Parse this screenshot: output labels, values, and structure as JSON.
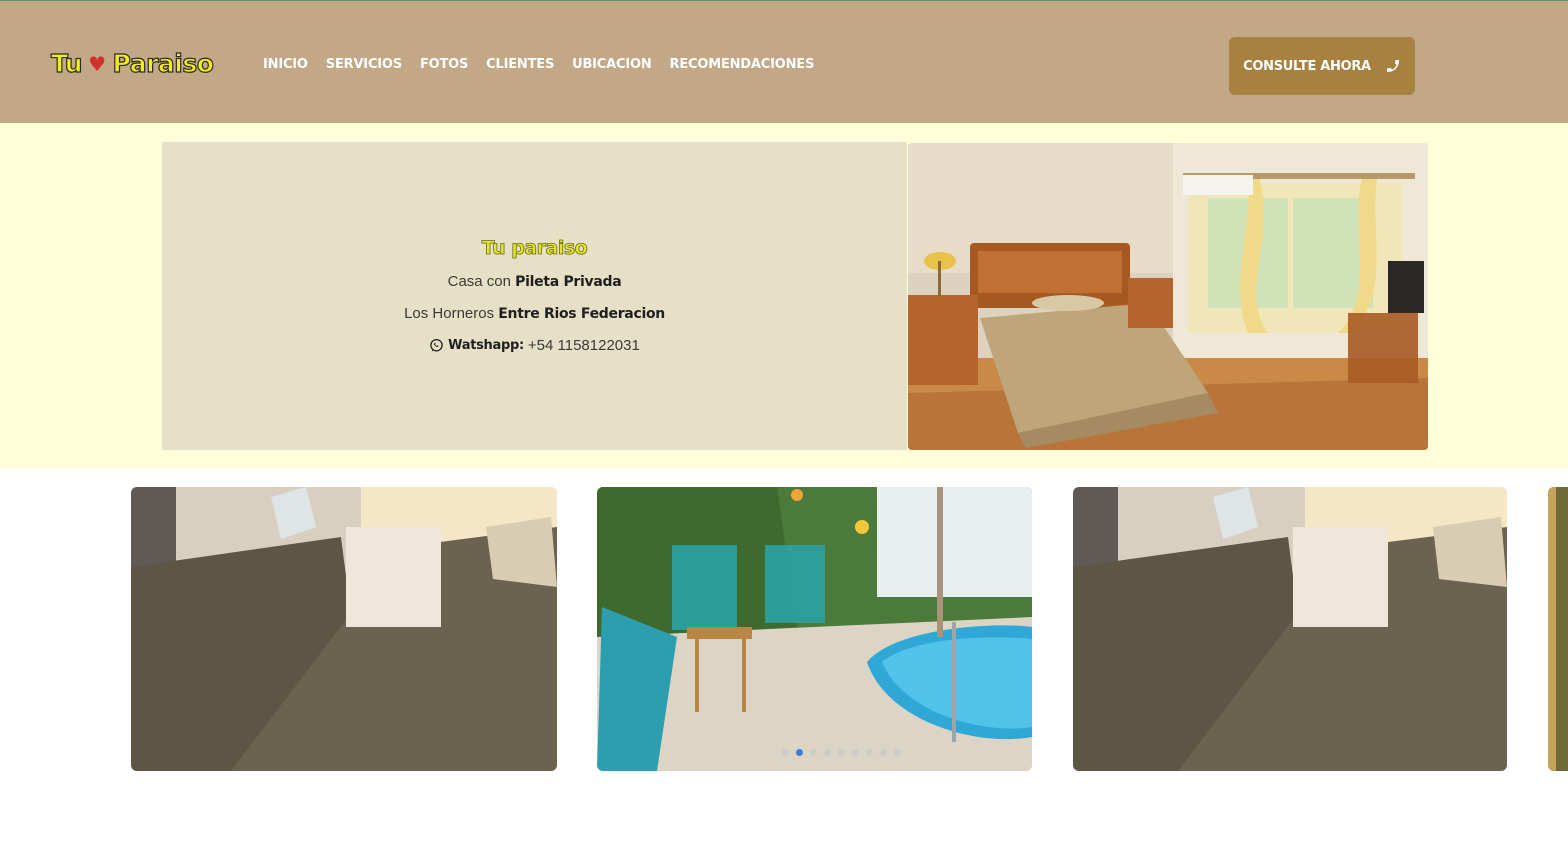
{
  "logo": {
    "word1": "Tu",
    "heart": "♥",
    "word2": "Paraiso"
  },
  "nav": {
    "items": [
      "INICIO",
      "SERVICIOS",
      "FOTOS",
      "CLIENTES",
      "UBICACION",
      "RECOMENDACIONES"
    ]
  },
  "cta": {
    "label": "CONSULTE AHORA",
    "icon": "phone-icon"
  },
  "hero": {
    "title": "Tu paraiso",
    "line1_prefix": "Casa con",
    "line1_bold": "Pileta Privada",
    "line2_prefix": "Los Horneros",
    "line2_bold": "Entre Rios Federacion",
    "whatsapp_label": "Watshapp:",
    "whatsapp_number": "+54 1158122031",
    "whatsapp_icon": "whatsapp-icon",
    "photo": "bedroom-photo"
  },
  "carousel": {
    "slides": [
      "twin-beds-photo",
      "pool-chairs-photo",
      "twin-beds-photo",
      "partial-photo"
    ],
    "dot_count": 9,
    "active_dot": 1
  },
  "colors": {
    "header_bg": "#c2a887",
    "cta_bg": "#a6813f",
    "hero_bg": "#fefed8",
    "info_box_bg": "#e5e0c6",
    "logo_yellow": "#f4ec1a",
    "heart_red": "#d3302a",
    "active_dot": "#1e6fd9"
  }
}
